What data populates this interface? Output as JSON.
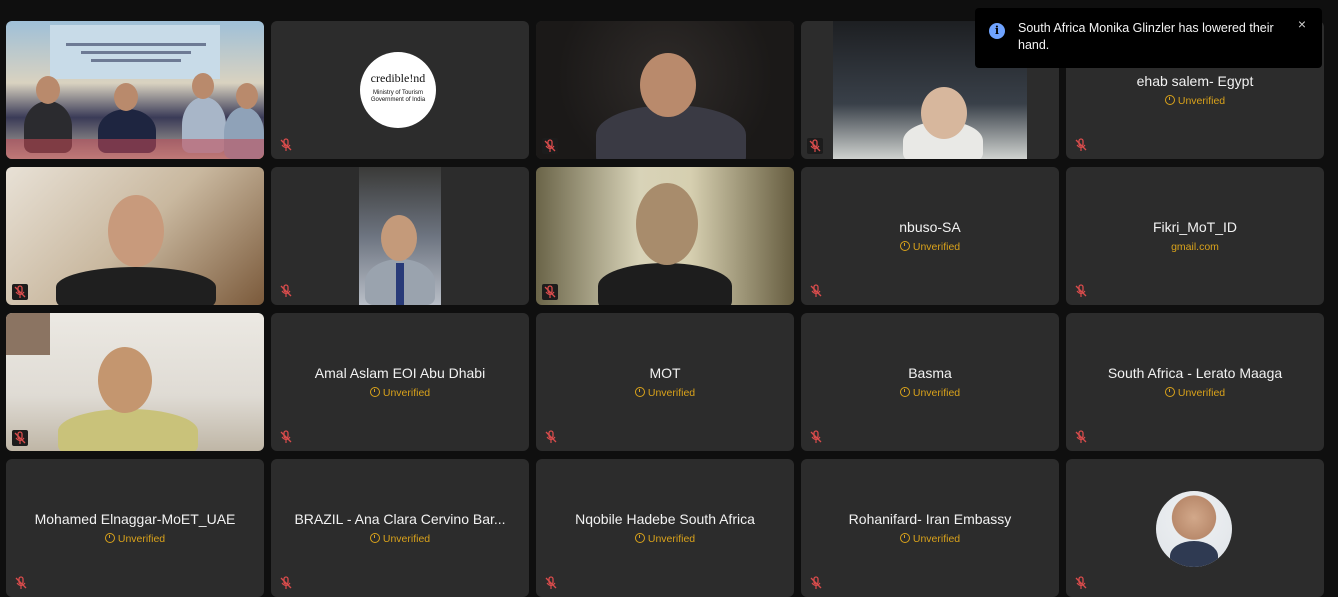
{
  "notification": {
    "message": "South Africa Monika Glinzler has lowered their hand.",
    "close_symbol": "×",
    "icon": "info-icon"
  },
  "logo": {
    "main": "credible!nd",
    "line1": "Ministry of Tourism",
    "line2": "Government of India"
  },
  "participants": [
    {
      "id": "p1",
      "type": "video",
      "scene": "ministry-panel"
    },
    {
      "id": "p2",
      "type": "logo"
    },
    {
      "id": "p3",
      "type": "video",
      "scene": "man-glasses-dark"
    },
    {
      "id": "p4",
      "type": "video",
      "scene": "woman-office"
    },
    {
      "id": "p5",
      "type": "name",
      "name": "ehab salem- Egypt",
      "sub": "Unverified",
      "verified": false
    },
    {
      "id": "p6",
      "type": "video",
      "scene": "man-room"
    },
    {
      "id": "p7",
      "type": "video",
      "scene": "man-suit"
    },
    {
      "id": "p8",
      "type": "video",
      "scene": "man-window"
    },
    {
      "id": "p9",
      "type": "name",
      "name": "nbuso-SA",
      "sub": "Unverified",
      "verified": false
    },
    {
      "id": "p10",
      "type": "name",
      "name": "Fikri_MoT_ID",
      "sub": "gmail.com",
      "verified": true
    },
    {
      "id": "p11",
      "type": "video",
      "scene": "man-office"
    },
    {
      "id": "p12",
      "type": "name",
      "name": "Amal Aslam EOI Abu Dhabi",
      "sub": "Unverified",
      "verified": false
    },
    {
      "id": "p13",
      "type": "name",
      "name": "MOT",
      "sub": "Unverified",
      "verified": false
    },
    {
      "id": "p14",
      "type": "name",
      "name": "Basma",
      "sub": "Unverified",
      "verified": false
    },
    {
      "id": "p15",
      "type": "name",
      "name": "South Africa - Lerato Maaga",
      "sub": "Unverified",
      "verified": false
    },
    {
      "id": "p16",
      "type": "name",
      "name": "Mohamed Elnaggar-MoET_UAE",
      "sub": "Unverified",
      "verified": false
    },
    {
      "id": "p17",
      "type": "name",
      "name": "BRAZIL - Ana Clara Cervino Bar...",
      "sub": "Unverified",
      "verified": false
    },
    {
      "id": "p18",
      "type": "name",
      "name": "Nqobile Hadebe South Africa",
      "sub": "Unverified",
      "verified": false
    },
    {
      "id": "p19",
      "type": "name",
      "name": "Rohanifard- Iran Embassy",
      "sub": "Unverified",
      "verified": false
    },
    {
      "id": "p20",
      "type": "avatar"
    }
  ],
  "colors": {
    "background": "#0f0f0f",
    "tile": "#2c2c2c",
    "unverified": "#d9a21b",
    "mic_muted": "#d94c4c"
  }
}
